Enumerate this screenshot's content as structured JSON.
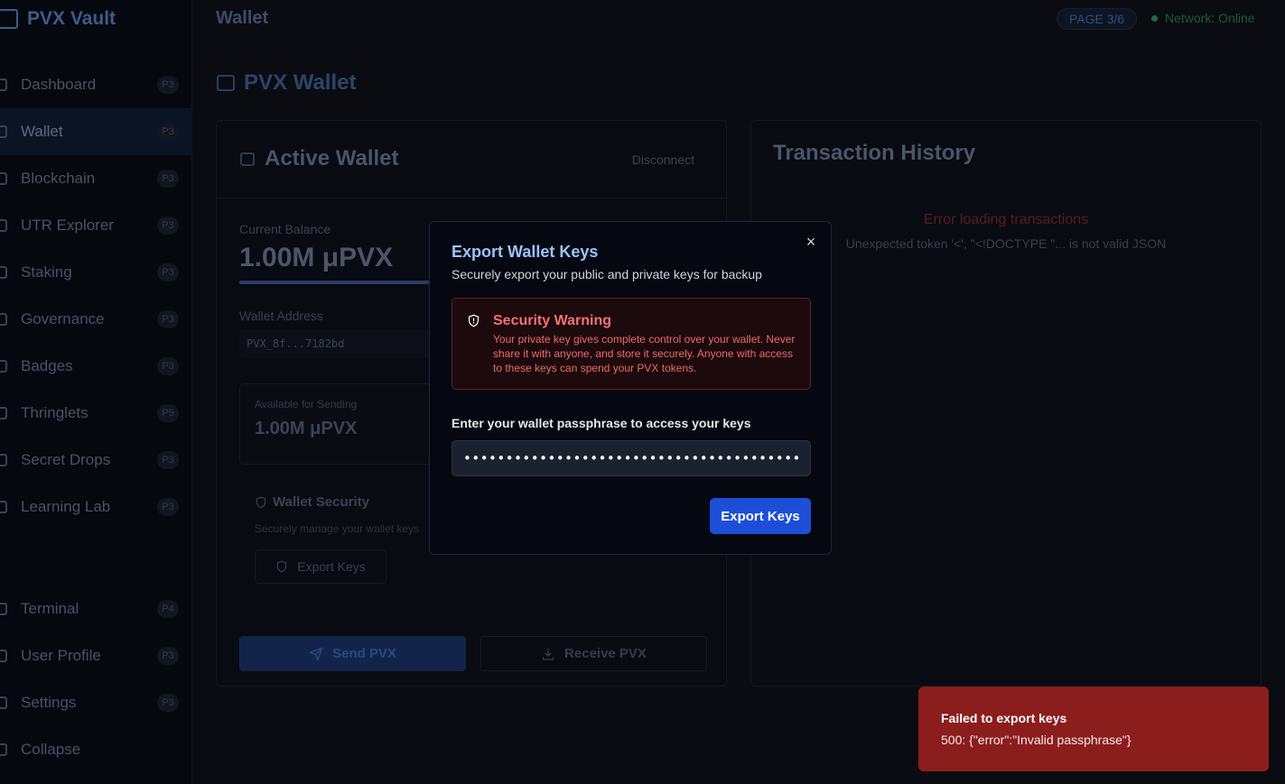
{
  "app": {
    "brand": "PVX Vault",
    "page_title": "Wallet",
    "page_indicator": "PAGE 3/6",
    "network_status": "Network: Online"
  },
  "sidebar": {
    "items": [
      {
        "label": "Dashboard",
        "badge": "P3",
        "icon": "dashboard-icon"
      },
      {
        "label": "Wallet",
        "badge": "P3",
        "icon": "wallet-icon",
        "active": true
      },
      {
        "label": "Blockchain",
        "badge": "P3",
        "icon": "blockchain-icon"
      },
      {
        "label": "UTR Explorer",
        "badge": "P3",
        "icon": "database-icon"
      },
      {
        "label": "Staking",
        "badge": "P3",
        "icon": "share-icon"
      },
      {
        "label": "Governance",
        "badge": "P3",
        "icon": "governance-icon"
      },
      {
        "label": "Badges",
        "badge": "P3",
        "icon": "badge-icon"
      },
      {
        "label": "Thringlets",
        "badge": "P5",
        "icon": "heart-icon"
      },
      {
        "label": "Secret Drops",
        "badge": "P3",
        "icon": "drop-icon"
      },
      {
        "label": "Learning Lab",
        "badge": "P3",
        "icon": "book-icon"
      }
    ],
    "bottom_items": [
      {
        "label": "Terminal",
        "badge": "P4",
        "icon": "terminal-icon"
      },
      {
        "label": "User Profile",
        "badge": "P3",
        "icon": "user-icon"
      },
      {
        "label": "Settings",
        "badge": "P3",
        "icon": "gear-icon"
      },
      {
        "label": "Collapse",
        "badge": "",
        "icon": "chevron-left-icon"
      }
    ]
  },
  "main": {
    "heading": "PVX Wallet",
    "active_wallet": {
      "title": "Active Wallet",
      "disconnect": "Disconnect",
      "balance_label": "Current Balance",
      "balance": "1.00M μPVX",
      "address_label": "Wallet Address",
      "address": "PVX_8f...7182bd",
      "available_label": "Available for Sending",
      "available": "1.00M μPVX",
      "security_title": "Wallet Security",
      "security_desc": "Securely manage your wallet keys",
      "export_button": "Export Keys",
      "send_button": "Send PVX",
      "receive_button": "Receive PVX"
    },
    "transactions": {
      "title": "Transaction History",
      "error_title": "Error loading transactions",
      "error_detail": "Unexpected token '<', \"<!DOCTYPE \"... is not valid JSON"
    }
  },
  "modal": {
    "title": "Export Wallet Keys",
    "subtitle": "Securely export your public and private keys for backup",
    "close": "×",
    "warning_title": "Security Warning",
    "warning_text": "Your private key gives complete control over your wallet. Never share it with anyone, and store it securely. Anyone with access to these keys can spend your PVX tokens.",
    "passphrase_label": "Enter your wallet passphrase to access your keys",
    "passphrase_value": "•••••••••••••••••••••••••••••••••••••••••••••••",
    "export_button": "Export Keys"
  },
  "toast": {
    "title": "Failed to export keys",
    "detail": "500: {\"error\":\"Invalid passphrase\"}"
  },
  "colors": {
    "accent": "#1d4ed8",
    "danger": "#8b1d1d",
    "warning_text": "#f87171",
    "online": "#1f6b3a"
  }
}
